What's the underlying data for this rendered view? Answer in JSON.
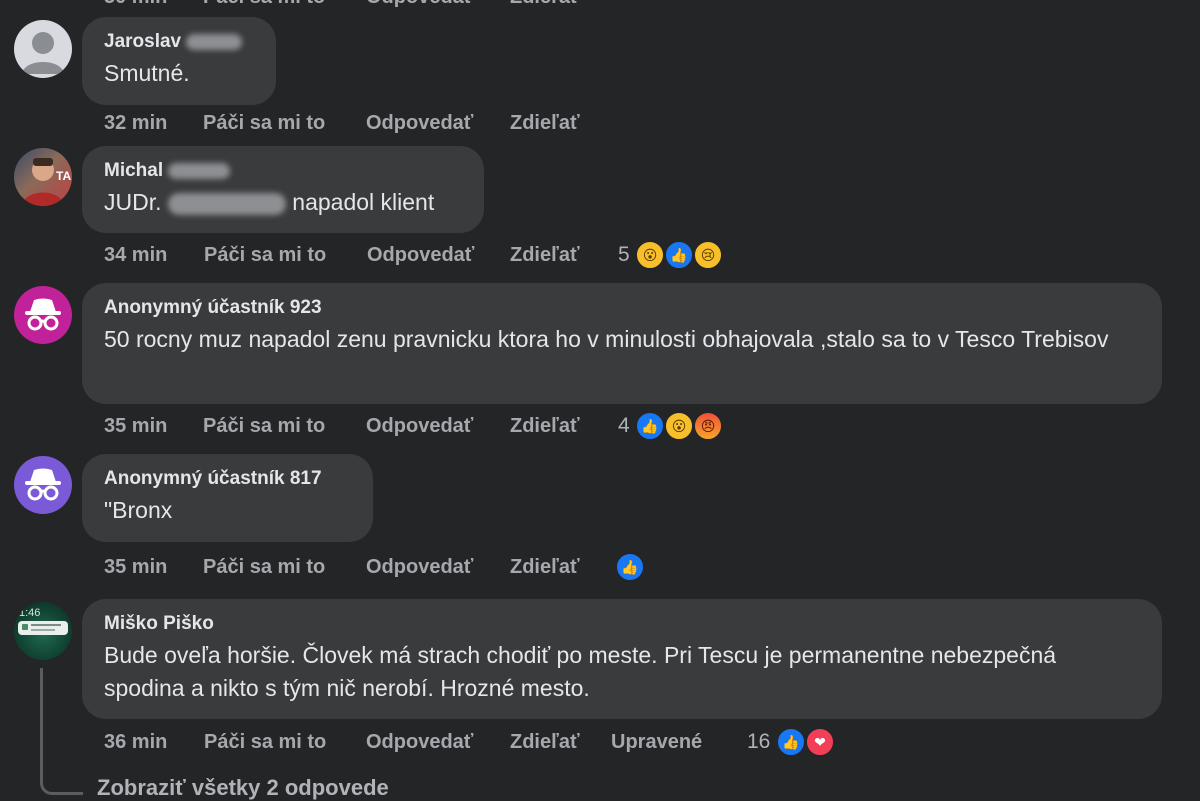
{
  "comments": [
    {
      "author_first": "Jaroslav",
      "text": "Smutné.",
      "time": "32 min",
      "like": "Páči sa mi to",
      "reply": "Odpovedať",
      "share": "Zdieľať"
    },
    {
      "author_first": "Michal",
      "text_prefix": "JUDr.",
      "text_suffix": "napadol klient",
      "time": "34 min",
      "like": "Páči sa mi to",
      "reply": "Odpovedať",
      "share": "Zdieľať",
      "reaction_count": "5",
      "reactions": [
        "wow",
        "like",
        "sad"
      ]
    },
    {
      "author": "Anonymný účastník 923",
      "text": "50 rocny muz napadol zenu pravnicku ktora ho v minulosti obhajovala ,stalo sa to v Tesco Trebisov",
      "time": "35 min",
      "like": "Páči sa mi to",
      "reply": "Odpovedať",
      "share": "Zdieľať",
      "reaction_count": "4",
      "reactions": [
        "like",
        "wow",
        "angry"
      ]
    },
    {
      "author": "Anonymný účastník 817",
      "text": "\"Bronx",
      "time": "35 min",
      "like": "Páči sa mi to",
      "reply": "Odpovedať",
      "share": "Zdieľať",
      "reactions": [
        "like"
      ]
    },
    {
      "author": "Miško Piško",
      "text": "Bude oveľa horšie. Človek má strach chodiť po meste. Pri Tescu je permanentne nebezpečná spodina a nikto s tým nič nerobí. Hrozné mesto.",
      "time": "36 min",
      "like": "Páči sa mi to",
      "reply": "Odpovedať",
      "share": "Zdieľať",
      "edited": "Upravené",
      "reaction_count": "16",
      "reactions": [
        "like",
        "love"
      ]
    }
  ],
  "view_replies": "Zobraziť všetky 2 odpovede",
  "colors": {
    "background": "#242526",
    "bubble": "#3a3b3c",
    "like_blue": "#1877f2",
    "love_red": "#f33e58"
  },
  "avatar_time_text": "1:46"
}
